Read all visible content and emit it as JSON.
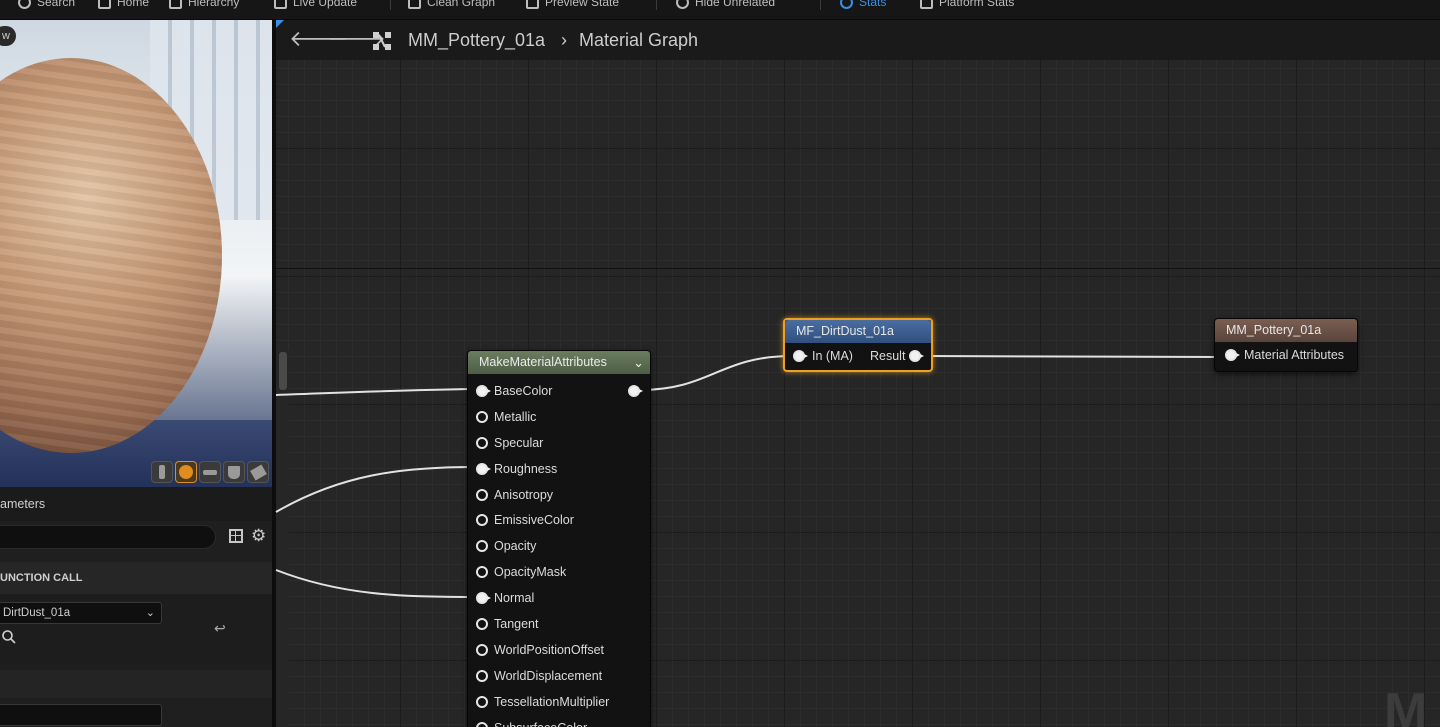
{
  "toolbar": {
    "items": [
      {
        "label": "Search",
        "icon": "search-icon"
      },
      {
        "label": "Home",
        "icon": "home-icon"
      },
      {
        "label": "Hierarchy",
        "icon": "hierarchy-icon"
      },
      {
        "label": "Live Update",
        "icon": "live-update-icon"
      },
      {
        "label": "Clean Graph",
        "icon": "clean-graph-icon"
      },
      {
        "label": "Preview State",
        "icon": "preview-state-icon"
      },
      {
        "label": "Hide Unrelated",
        "icon": "hide-unrelated-icon"
      },
      {
        "label": "Stats",
        "icon": "stats-icon"
      },
      {
        "label": "Platform Stats",
        "icon": "platform-stats-icon"
      }
    ],
    "accent": "#3a8ee6"
  },
  "viewport": {
    "tab_label": "w",
    "preview_shapes": [
      "cylinder",
      "sphere",
      "plane",
      "cube",
      "custom-mesh"
    ],
    "active_shape": "sphere"
  },
  "params_panel": {
    "title": "ameters",
    "search_placeholder": "",
    "section_header": "UNCTION CALL",
    "function_value": "DirtDust_01a"
  },
  "breadcrumb": {
    "asset": "MM_Pottery_01a",
    "graph": "Material Graph"
  },
  "nodes": {
    "make_material_attributes": {
      "title": "MakeMaterialAttributes",
      "header_color": "#5b6d52",
      "pins": [
        {
          "label": "BaseColor",
          "connected": true
        },
        {
          "label": "Metallic",
          "connected": false
        },
        {
          "label": "Specular",
          "connected": false
        },
        {
          "label": "Roughness",
          "connected": true
        },
        {
          "label": "Anisotropy",
          "connected": false
        },
        {
          "label": "EmissiveColor",
          "connected": false
        },
        {
          "label": "Opacity",
          "connected": false
        },
        {
          "label": "OpacityMask",
          "connected": false
        },
        {
          "label": "Normal",
          "connected": true
        },
        {
          "label": "Tangent",
          "connected": false
        },
        {
          "label": "WorldPositionOffset",
          "connected": false
        },
        {
          "label": "WorldDisplacement",
          "connected": false
        },
        {
          "label": "TessellationMultiplier",
          "connected": false
        },
        {
          "label": "SubsurfaceColor",
          "connected": false
        }
      ]
    },
    "dirt_dust": {
      "title": "MF_DirtDust_01a",
      "input": "In (MA)",
      "output": "Result",
      "selection_color": "#f0a020"
    },
    "pottery_output": {
      "title": "MM_Pottery_01a",
      "input": "Material Attributes"
    }
  },
  "watermark": "M"
}
